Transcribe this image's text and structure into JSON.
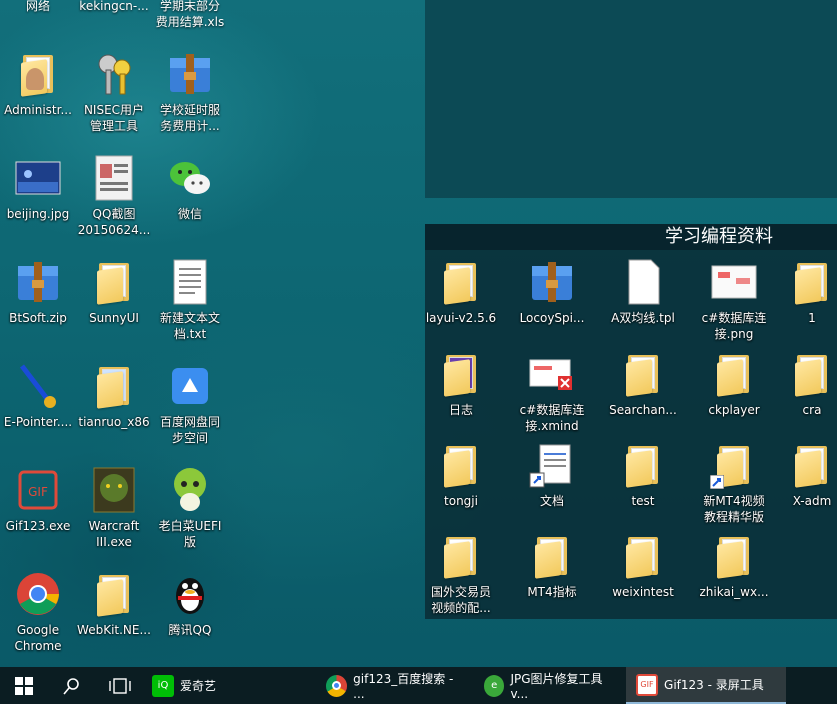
{
  "top_row": [
    "网络",
    "kekingcn-...",
    "学期末部分\n费用结算.xls"
  ],
  "desktop_icons": [
    {
      "label": "Administr...",
      "icon": "user-folder-icon"
    },
    {
      "label": "NISEC用户\n管理工具",
      "icon": "keys-icon"
    },
    {
      "label": "学校延时服\n务费用计...",
      "icon": "winrar-archive-icon"
    },
    {
      "label": "beijing.jpg",
      "icon": "image-file-icon"
    },
    {
      "label": "QQ截图\n20150624...",
      "icon": "screenshot-image-icon"
    },
    {
      "label": "微信",
      "icon": "wechat-icon"
    },
    {
      "label": "BtSoft.zip",
      "icon": "winrar-archive-icon"
    },
    {
      "label": "SunnyUI",
      "icon": "folder-icon"
    },
    {
      "label": "新建文本文\n档.txt",
      "icon": "text-file-icon"
    },
    {
      "label": "E-Pointer....",
      "icon": "pointer-tool-icon"
    },
    {
      "label": "tianruo_x86",
      "icon": "folder-icon"
    },
    {
      "label": "百度网盘同\n步空间",
      "icon": "baidu-netdisk-icon"
    },
    {
      "label": "Gif123.exe",
      "icon": "gif123-icon"
    },
    {
      "label": "Warcraft\nIII.exe",
      "icon": "warcraft-icon"
    },
    {
      "label": "老白菜UEFI\n版",
      "icon": "cabbage-icon"
    },
    {
      "label": "Google\nChrome",
      "icon": "chrome-icon"
    },
    {
      "label": "WebKit.NE...",
      "icon": "folder-icon"
    },
    {
      "label": "腾讯QQ",
      "icon": "qq-icon"
    }
  ],
  "fence": {
    "title": "学习编程资料",
    "items": [
      {
        "label": "layui-v2.5.6",
        "icon": "folder-icon"
      },
      {
        "label": "LocoySpi...",
        "icon": "winrar-archive-icon"
      },
      {
        "label": "A双均线.tpl",
        "icon": "blank-file-icon"
      },
      {
        "label": "c#数据库连\n接.png",
        "icon": "image-file-icon"
      },
      {
        "label": "1",
        "icon": "folder-icon"
      },
      {
        "label": "日志",
        "icon": "vs-folder-icon"
      },
      {
        "label": "c#数据库连\n接.xmind",
        "icon": "xmind-file-icon"
      },
      {
        "label": "Searchan...",
        "icon": "folder-icon"
      },
      {
        "label": "ckplayer",
        "icon": "folder-icon"
      },
      {
        "label": "cra",
        "icon": "folder-icon"
      },
      {
        "label": "tongji",
        "icon": "folder-icon"
      },
      {
        "label": "文档",
        "icon": "document-shortcut-icon"
      },
      {
        "label": "test",
        "icon": "folder-icon"
      },
      {
        "label": "新MT4视频\n教程精华版",
        "icon": "folder-shortcut-icon"
      },
      {
        "label": "X-adm",
        "icon": "folder-icon"
      },
      {
        "label": "国外交易员\n视频的配...",
        "icon": "folder-icon"
      },
      {
        "label": "MT4指标",
        "icon": "folder-icon"
      },
      {
        "label": "weixintest",
        "icon": "folder-icon"
      },
      {
        "label": "zhikai_wx...",
        "icon": "folder-icon"
      }
    ]
  },
  "taskbar": {
    "pinned_label": "爱奇艺",
    "apps": [
      {
        "label": "gif123_百度搜索 - ...",
        "icon": "chrome-icon"
      },
      {
        "label": "JPG图片修复工具 v...",
        "icon": "jpg-repair-icon"
      },
      {
        "label": "Gif123 - 录屏工具",
        "icon": "gif123-icon",
        "active": true
      }
    ]
  }
}
